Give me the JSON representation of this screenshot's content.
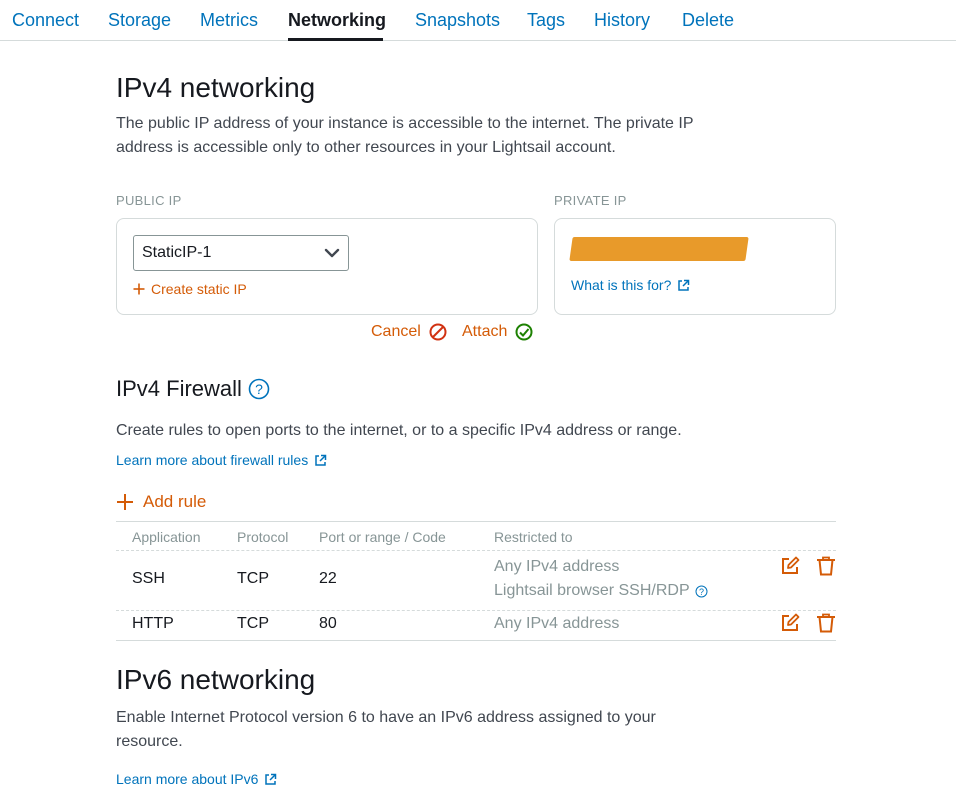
{
  "tabs": [
    {
      "label": "Connect"
    },
    {
      "label": "Storage"
    },
    {
      "label": "Metrics"
    },
    {
      "label": "Networking",
      "active": true
    },
    {
      "label": "Snapshots"
    },
    {
      "label": "Tags"
    },
    {
      "label": "History"
    },
    {
      "label": "Delete"
    }
  ],
  "ipv4": {
    "title": "IPv4 networking",
    "description": "The public IP address of your instance is accessible to the internet. The private IP address is accessible only to other resources in your Lightsail account.",
    "public_ip_label": "PUBLIC IP",
    "private_ip_label": "PRIVATE IP",
    "static_ip_value": "StaticIP-1",
    "create_static_ip": "Create static IP",
    "what_is_this": "What is this for?",
    "cancel_label": "Cancel",
    "attach_label": "Attach"
  },
  "firewall": {
    "title": "IPv4 Firewall",
    "description": "Create rules to open ports to the internet, or to a specific IPv4 address or range.",
    "learn_more": "Learn more about firewall rules",
    "add_rule": "Add rule",
    "columns": [
      "Application",
      "Protocol",
      "Port or range / Code",
      "Restricted to"
    ],
    "rows": [
      {
        "application": "SSH",
        "protocol": "TCP",
        "port": "22",
        "restricted": "Any IPv4 address",
        "restricted2": "Lightsail browser SSH/RDP"
      },
      {
        "application": "HTTP",
        "protocol": "TCP",
        "port": "80",
        "restricted": "Any IPv4 address"
      }
    ]
  },
  "ipv6": {
    "title": "IPv6 networking",
    "description": "Enable Internet Protocol version 6 to have an IPv6 address assigned to your resource.",
    "learn_more": "Learn more about IPv6"
  },
  "colors": {
    "link": "#0073bb",
    "accent_orange": "#d45b07",
    "cancel_red": "#d13212",
    "attach_green": "#1d8102",
    "redaction": "#e89a2a"
  }
}
